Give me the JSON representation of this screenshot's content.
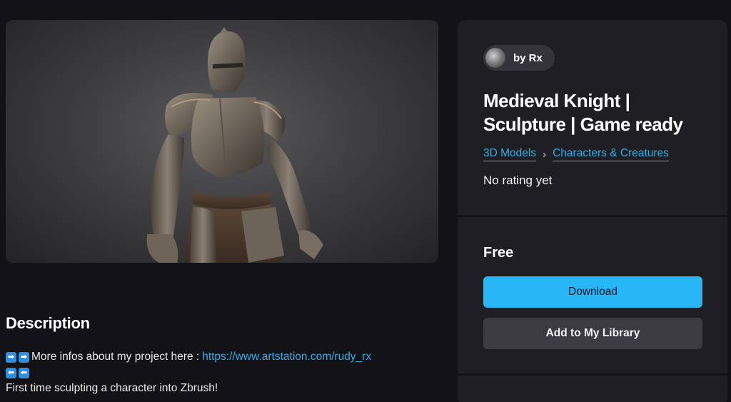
{
  "product": {
    "author": "by Rx",
    "title_line1": "Medieval Knight |",
    "title_line2": "Sculpture | Game ready",
    "breadcrumb": [
      "3D Models",
      "Characters & Creatures"
    ],
    "rating": "No rating yet",
    "price": "Free"
  },
  "actions": {
    "download": "Download",
    "library": "Add to My Library"
  },
  "description": {
    "heading": "Description",
    "line1_text": "More infos about my project here :",
    "line1_link": "https://www.artstation.com/rudy_rx",
    "line3": "First time sculpting a character into Zbrush!"
  },
  "icons": {
    "right_arrow": "➡",
    "left_arrow": "⬅",
    "chevron": "›"
  },
  "colors": {
    "accent": "#29b6f6",
    "link": "#35aee8",
    "background": "#121217",
    "panel": "#1e1e23"
  }
}
